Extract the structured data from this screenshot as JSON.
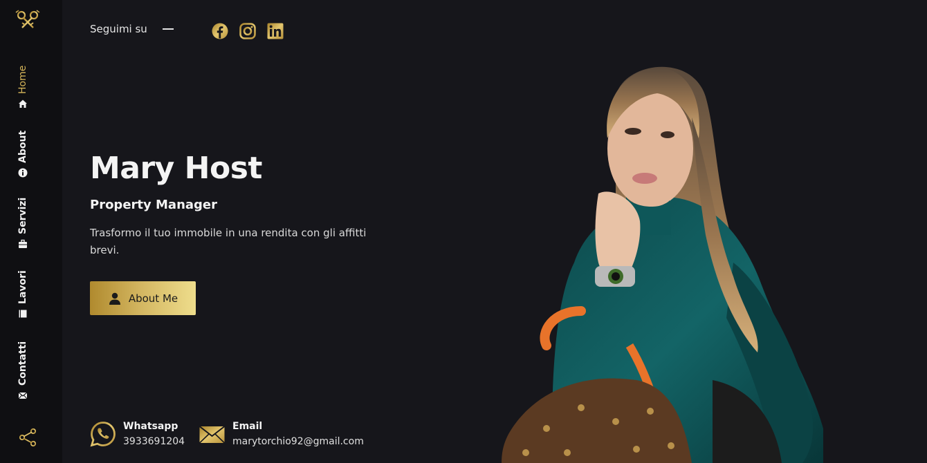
{
  "sidebar": {
    "items": [
      {
        "label": "Home",
        "icon": "home-icon",
        "active": true
      },
      {
        "label": "About",
        "icon": "info-icon"
      },
      {
        "label": "Servizi",
        "icon": "briefcase-icon"
      },
      {
        "label": "Lavori",
        "icon": "book-icon"
      },
      {
        "label": "Contatti",
        "icon": "envelope-icon"
      }
    ],
    "share_icon": "share-icon",
    "logo_icon": "keys-logo-icon"
  },
  "follow": {
    "label": "Seguimi su",
    "socials": [
      "facebook-icon",
      "instagram-icon",
      "linkedin-icon"
    ]
  },
  "hero": {
    "name": "Mary Host",
    "role": "Property Manager",
    "description": "Trasformo il tuo immobile in una rendita con gli affitti brevi.",
    "button_label": "About Me"
  },
  "contacts": [
    {
      "label": "Whatsapp",
      "value": "3933691204",
      "icon": "whatsapp-icon"
    },
    {
      "label": "Email",
      "value": "marytorchio92@gmail.com",
      "icon": "envelope-icon"
    }
  ],
  "colors": {
    "background": "#16161b",
    "sidebar": "#0f0f12",
    "accent_gold": "#d7b65a",
    "accent_gold_light": "#eedd8c",
    "text": "#f4f4f4"
  }
}
